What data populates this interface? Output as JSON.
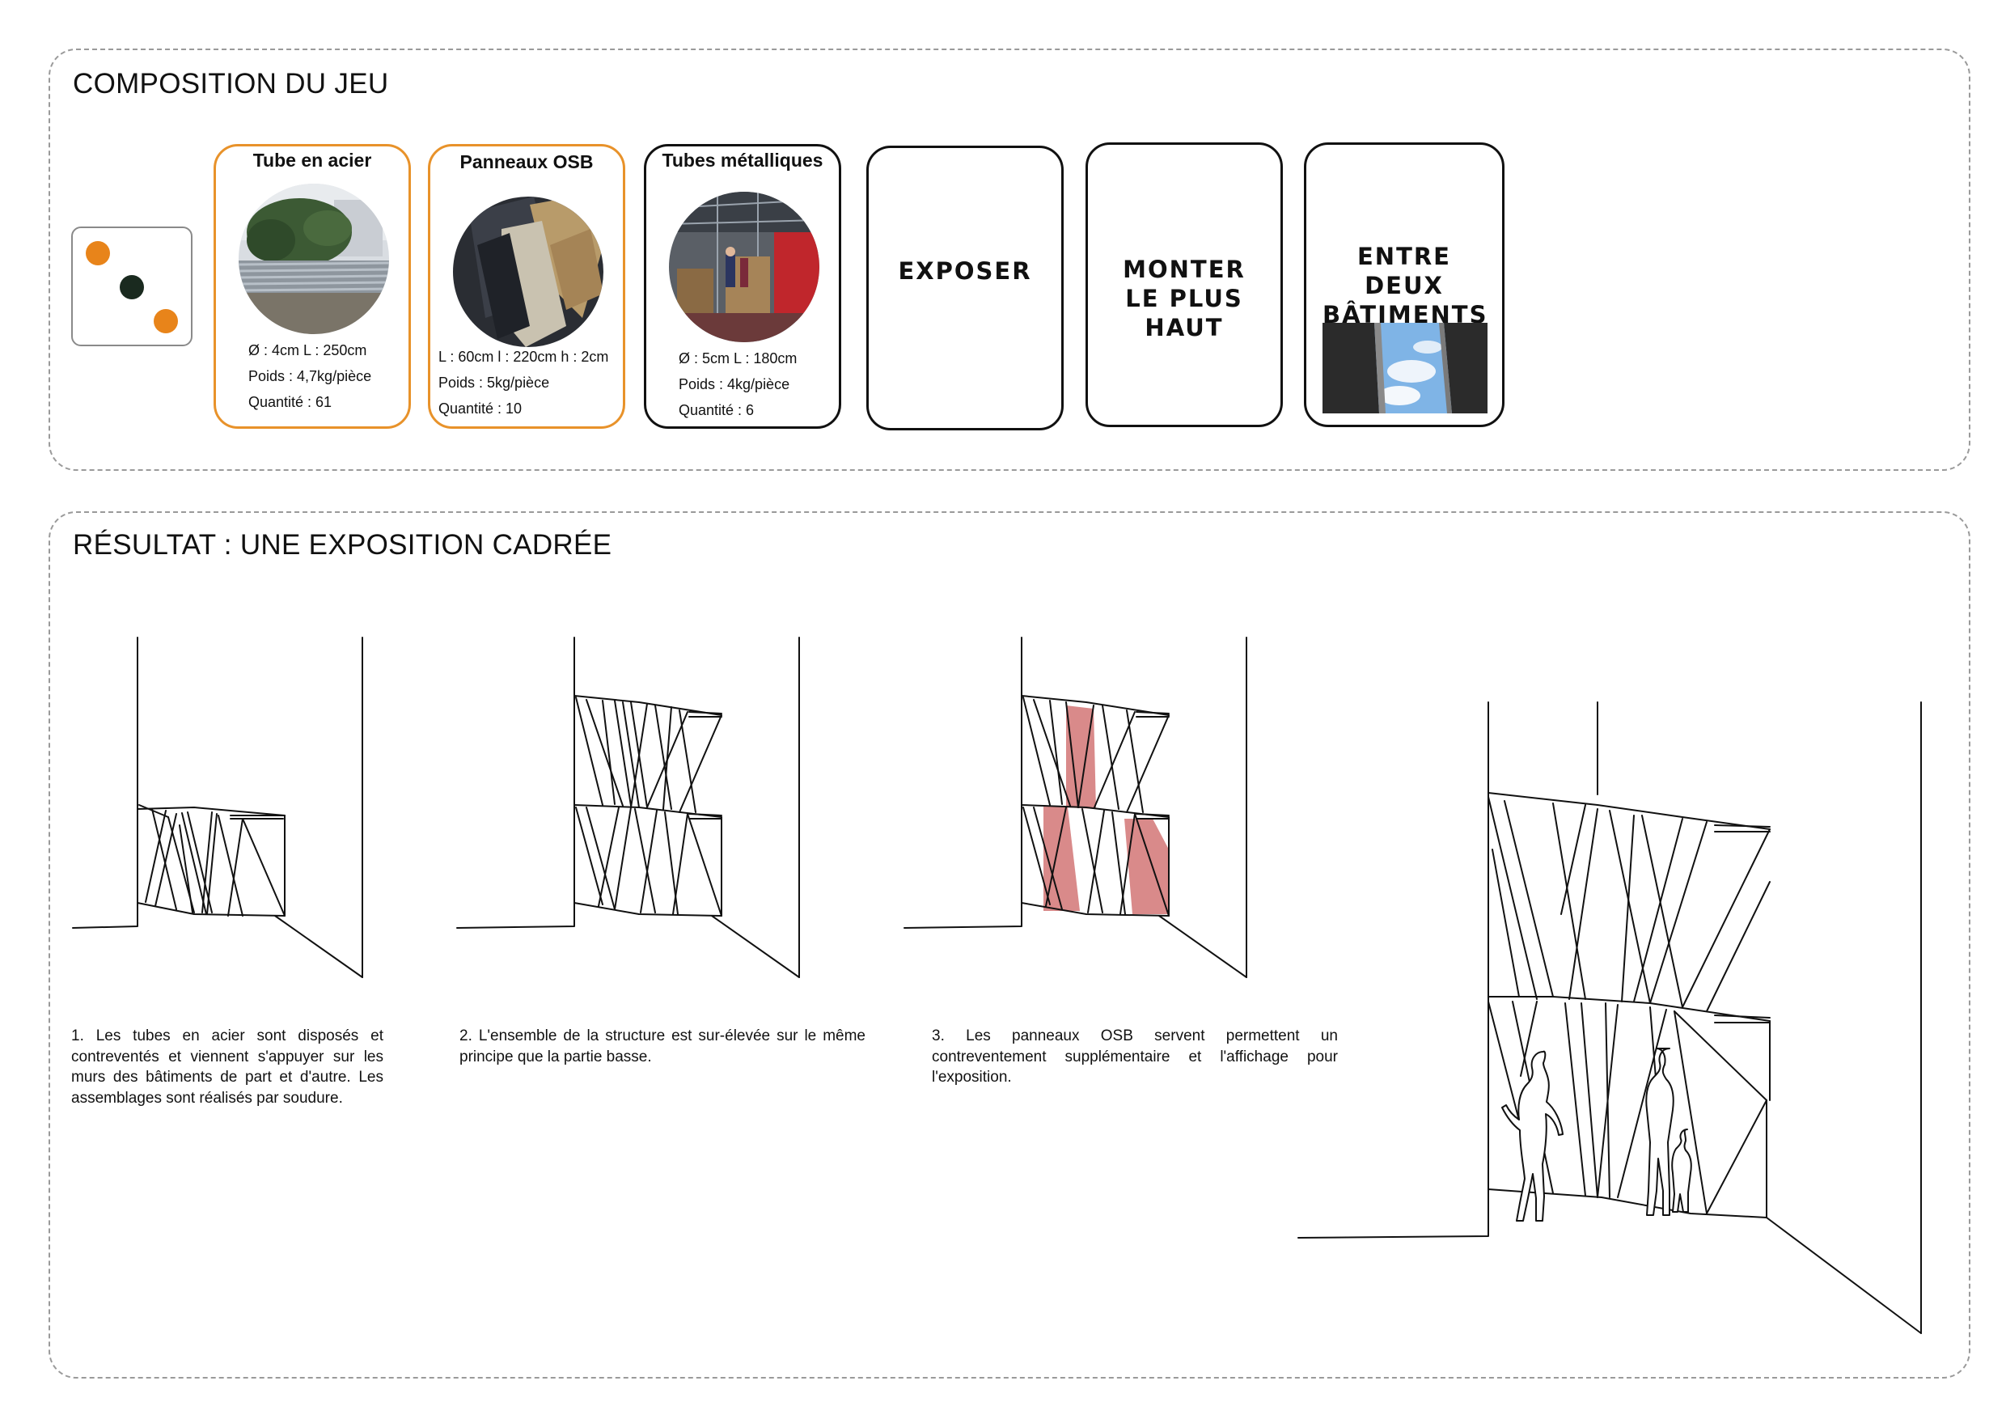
{
  "section1": {
    "title": "COMPOSITION DU JEU"
  },
  "dice": {
    "dot_colors": [
      "#e8841a",
      "#1a2a1f",
      "#e8841a"
    ]
  },
  "cards": [
    {
      "title": "Tube en acier",
      "border": "orange",
      "specs": [
        "Ø : 4cm   L : 250cm",
        "Poids : 4,7kg/pièce",
        "Quantité : 61"
      ]
    },
    {
      "title": "Panneaux OSB",
      "border": "orange",
      "specs": [
        "L : 60cm   l : 220cm h : 2cm",
        "Poids : 5kg/pièce",
        "Quantité : 10"
      ]
    },
    {
      "title": "Tubes métalliques",
      "border": "black",
      "specs": [
        "Ø : 5cm   L : 180cm",
        "Poids : 4kg/pièce",
        "Quantité : 6"
      ]
    },
    {
      "title": "EXPOSER",
      "border": "black"
    },
    {
      "title": "MONTER LE PLUS HAUT",
      "border": "black"
    },
    {
      "title": "ENTRE DEUX BÂTIMENTS",
      "border": "black"
    }
  ],
  "section2": {
    "title": "RÉSULTAT : UNE EXPOSITION CADRÉE"
  },
  "captions": [
    "1. Les tubes en acier sont disposés et contreventés et viennent s'appuyer sur les murs des bâtiments de part et d'autre. Les assemblages sont réalisés par soudure.",
    "2. L'ensemble de la structure est sur-élevée sur le même principe que la partie basse.",
    "3. Les panneaux OSB servent permettent un contreventement supplémentaire et l'affichage pour l'exposition."
  ],
  "colors": {
    "orange": "#e8922a",
    "panel_fill": "#d98a8a",
    "border_dashed": "#9a9a9a"
  }
}
